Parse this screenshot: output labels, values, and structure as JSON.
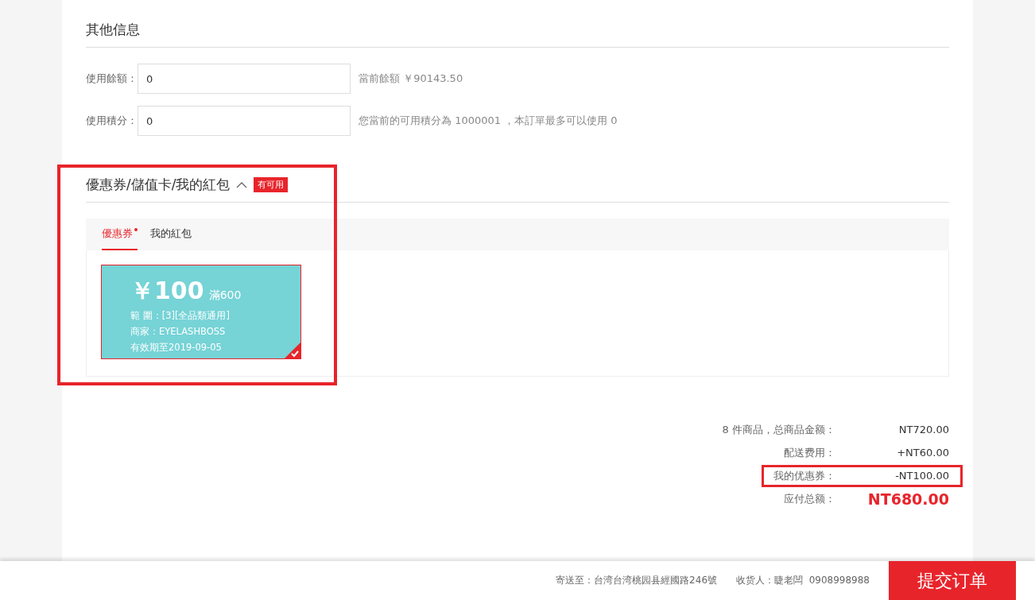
{
  "other_info": {
    "title": "其他信息",
    "fields": [
      {
        "label": "使用餘額：",
        "value": "0",
        "note": "當前餘額 ￥90143.50"
      },
      {
        "label": "使用積分：",
        "value": "0",
        "note": "您當前的可用積分為 1000001 ，本訂單最多可以使用 0"
      }
    ]
  },
  "coupons": {
    "title": "優惠券/儲值卡/我的紅包",
    "expanded": true,
    "badge": "有可用",
    "highlighted": true,
    "tabs": [
      {
        "label": "優惠券",
        "selected": true,
        "has_new": true
      },
      {
        "label": "我的紅包",
        "selected": false,
        "has_new": false
      }
    ],
    "cards": [
      {
        "amount": "￥100",
        "condition": "滿600",
        "scope": "範 圍：[3][全品類通用]",
        "merchant": "商家：EYELASHBOSS",
        "expiry": "有效期至2019-09-05",
        "selected": true
      }
    ]
  },
  "summary": [
    {
      "label": "8 件商品，总商品金额：",
      "value": "NT720.00",
      "kind": "normal",
      "highlighted": false
    },
    {
      "label": "配送费用：",
      "value": "+NT60.00",
      "kind": "normal",
      "highlighted": false
    },
    {
      "label": "我的优惠券：",
      "value": "-NT100.00",
      "kind": "normal",
      "highlighted": true
    },
    {
      "label": "应付总额：",
      "value": "NT680.00",
      "kind": "total",
      "highlighted": false
    }
  ],
  "footer": {
    "address": "寄送至：台湾台湾桃园县經國路246號",
    "receiver": "收货人：睫老闆  0908998988",
    "submit": "提交订单"
  }
}
